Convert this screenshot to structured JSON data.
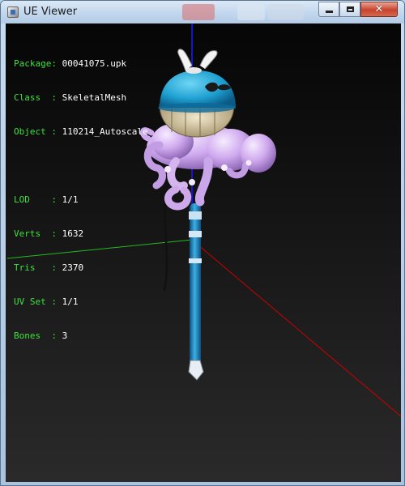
{
  "window": {
    "title": "UE Viewer"
  },
  "controls": {
    "minimize": "minimize",
    "maximize": "maximize",
    "close": "close"
  },
  "info": [
    {
      "label": "Package:",
      "value": "00041075.upk"
    },
    {
      "label": "Class  :",
      "value": "SkeletalMesh"
    },
    {
      "label": "Object :",
      "value": "110214_Autoscale"
    },
    {
      "label": "",
      "value": ""
    },
    {
      "label": "LOD    :",
      "value": "1/1"
    },
    {
      "label": "Verts  :",
      "value": "1632"
    },
    {
      "label": "Tris   :",
      "value": "2370"
    },
    {
      "label": "UV Set :",
      "value": "1/1"
    },
    {
      "label": "Bones  :",
      "value": "3"
    }
  ],
  "colors": {
    "label_green": "#3fe03f",
    "axis_x": "#cc0000",
    "axis_y": "#1a1aff",
    "axis_z": "#22bb22",
    "staff_blue": "#2a8fc9",
    "tentacle_purple": "#c9a3e6"
  }
}
